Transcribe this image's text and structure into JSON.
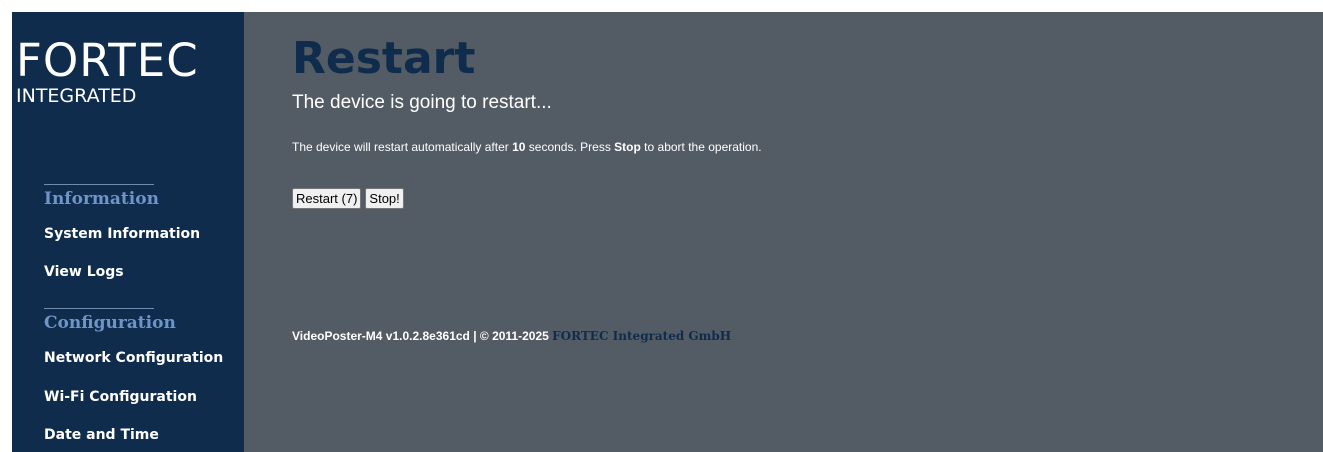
{
  "logo": {
    "main": "FORTEC",
    "sub": "INTEGRATED"
  },
  "sidebar": {
    "sections": [
      {
        "title": "Information",
        "items": [
          "System Information",
          "View Logs"
        ]
      },
      {
        "title": "Configuration",
        "items": [
          "Network Configuration",
          "Wi-Fi Configuration",
          "Date and Time"
        ]
      }
    ]
  },
  "main": {
    "title": "Restart",
    "subtitle": "The device is going to restart...",
    "info": {
      "part1": "The device will restart automatically after ",
      "seconds": "10",
      "part2": " seconds. Press ",
      "stop_word": "Stop",
      "part3": " to abort the operation."
    },
    "buttons": {
      "restart": "Restart (7)",
      "stop": "Stop!"
    }
  },
  "footer": {
    "version": "VideoPoster-M4 v1.0.2.8e361cd | © 2011-2025 ",
    "company": "FORTEC Integrated GmbH"
  },
  "colors": {
    "sidebar_bg": "#0f2c4d",
    "main_bg": "#535b64",
    "section_title": "#6f95c8",
    "title": "#0f2c4d"
  }
}
